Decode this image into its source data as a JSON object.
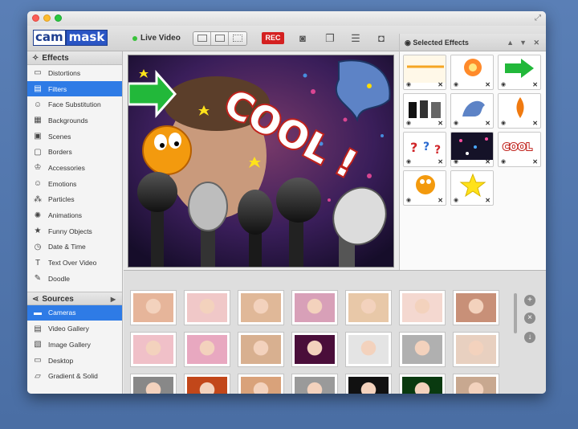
{
  "app": {
    "logo_part1": "cam",
    "logo_part2": "mask",
    "live_label": "Live Video",
    "rec_label": "REC",
    "accent": "#2e7be6",
    "rec_color": "#d42020"
  },
  "sidebar": {
    "effects_header": "Effects",
    "effects": [
      {
        "label": "Distortions",
        "icon": "distortions-icon",
        "glyph": "▭"
      },
      {
        "label": "Filters",
        "icon": "filters-icon",
        "glyph": "▤",
        "selected": true
      },
      {
        "label": "Face Substitution",
        "icon": "face-substitution-icon",
        "glyph": "☺"
      },
      {
        "label": "Backgrounds",
        "icon": "backgrounds-icon",
        "glyph": "▦"
      },
      {
        "label": "Scenes",
        "icon": "scenes-icon",
        "glyph": "▣"
      },
      {
        "label": "Borders",
        "icon": "borders-icon",
        "glyph": "▢"
      },
      {
        "label": "Accessories",
        "icon": "accessories-icon",
        "glyph": "♔"
      },
      {
        "label": "Emotions",
        "icon": "emotions-icon",
        "glyph": "☺"
      },
      {
        "label": "Particles",
        "icon": "particles-icon",
        "glyph": "⁂"
      },
      {
        "label": "Animations",
        "icon": "animations-icon",
        "glyph": "✺"
      },
      {
        "label": "Funny Objects",
        "icon": "funny-objects-icon",
        "glyph": "★"
      },
      {
        "label": "Date & Time",
        "icon": "date-time-icon",
        "glyph": "◷"
      },
      {
        "label": "Text Over Video",
        "icon": "text-over-video-icon",
        "glyph": "T"
      },
      {
        "label": "Doodle",
        "icon": "doodle-icon",
        "glyph": "✎"
      }
    ],
    "sources_header": "Sources",
    "sources": [
      {
        "label": "Cameras",
        "icon": "cameras-icon",
        "glyph": "▬",
        "selected": true
      },
      {
        "label": "Video Gallery",
        "icon": "video-gallery-icon",
        "glyph": "▤"
      },
      {
        "label": "Image Gallery",
        "icon": "image-gallery-icon",
        "glyph": "▧"
      },
      {
        "label": "Desktop",
        "icon": "desktop-icon",
        "glyph": "▭"
      },
      {
        "label": "Gradient & Solid",
        "icon": "gradient-solid-icon",
        "glyph": "▱"
      }
    ]
  },
  "preview": {
    "overlay_text": "COOL !"
  },
  "selected_effects": {
    "title": "Selected Effects",
    "tiles": [
      {
        "name": "sparkle-line-effect"
      },
      {
        "name": "explosion-effect"
      },
      {
        "name": "green-arrow-effect"
      },
      {
        "name": "microphones-effect"
      },
      {
        "name": "dragon-effect"
      },
      {
        "name": "flame-effect"
      },
      {
        "name": "question-marks-effect"
      },
      {
        "name": "stars-particles-effect"
      },
      {
        "name": "cool-text-effect",
        "text": "COOL"
      },
      {
        "name": "smiley-face-effect"
      },
      {
        "name": "star-effect"
      }
    ]
  },
  "gallery": {
    "rows": 3,
    "cols": 7
  }
}
